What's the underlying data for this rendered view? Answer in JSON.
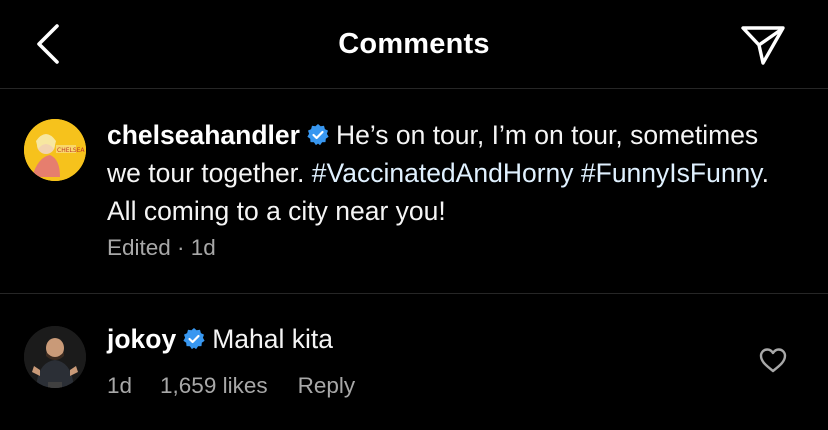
{
  "header": {
    "title": "Comments",
    "back_icon": "chevron-left-icon",
    "share_icon": "paper-plane-icon"
  },
  "caption": {
    "username": "chelseahandler",
    "verified_icon": "verified-badge-icon",
    "text": "He’s on tour, I’m on tour, sometimes we tour together.",
    "hashtag_1": "#VaccinatedAndHorny",
    "hashtag_2": "#FunnyIsFunny",
    "text_after": ". All coming to a city near you!",
    "meta": "Edited · 1d"
  },
  "comments": [
    {
      "username": "jokoy",
      "verified_icon": "verified-badge-icon",
      "text": "Mahal kita",
      "time": "1d",
      "likes": "1,659 likes",
      "reply_label": "Reply",
      "like_icon": "heart-outline-icon"
    }
  ],
  "colors": {
    "background": "#000000",
    "text": "#f5f5f5",
    "meta": "#a8a8a8",
    "divider": "#262626",
    "verified_blue": "#3897f0",
    "hashtag": "#e0f1ff"
  }
}
